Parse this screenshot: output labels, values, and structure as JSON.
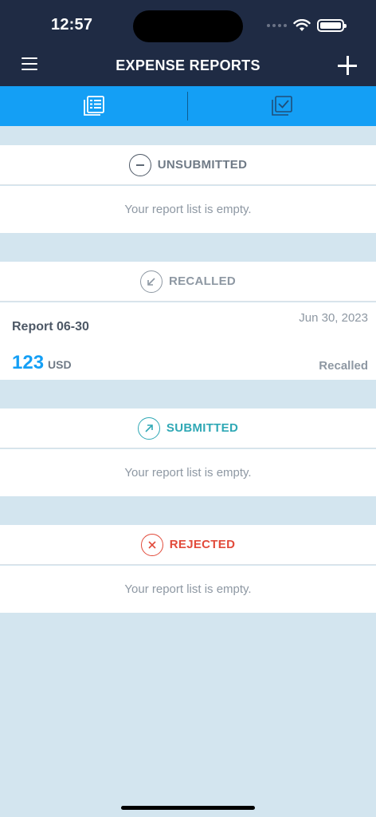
{
  "status_bar": {
    "time": "12:57"
  },
  "header": {
    "title": "EXPENSE REPORTS"
  },
  "tabs": [
    {
      "icon": "reports-list-icon"
    },
    {
      "icon": "approvals-icon"
    }
  ],
  "sections": {
    "unsubmitted": {
      "label": "UNSUBMITTED",
      "empty_text": "Your report list is empty.",
      "color": "#6f7a86"
    },
    "recalled": {
      "label": "RECALLED",
      "color": "#8e98a3"
    },
    "submitted": {
      "label": "SUBMITTED",
      "empty_text": "Your report list is empty.",
      "color": "#2fa8b5"
    },
    "rejected": {
      "label": "REJECTED",
      "empty_text": "Your report list is empty.",
      "color": "#e24b3b"
    }
  },
  "reports": [
    {
      "name": "Report 06-30",
      "date": "Jun 30, 2023",
      "amount": "123",
      "currency": "USD",
      "status": "Recalled"
    }
  ]
}
